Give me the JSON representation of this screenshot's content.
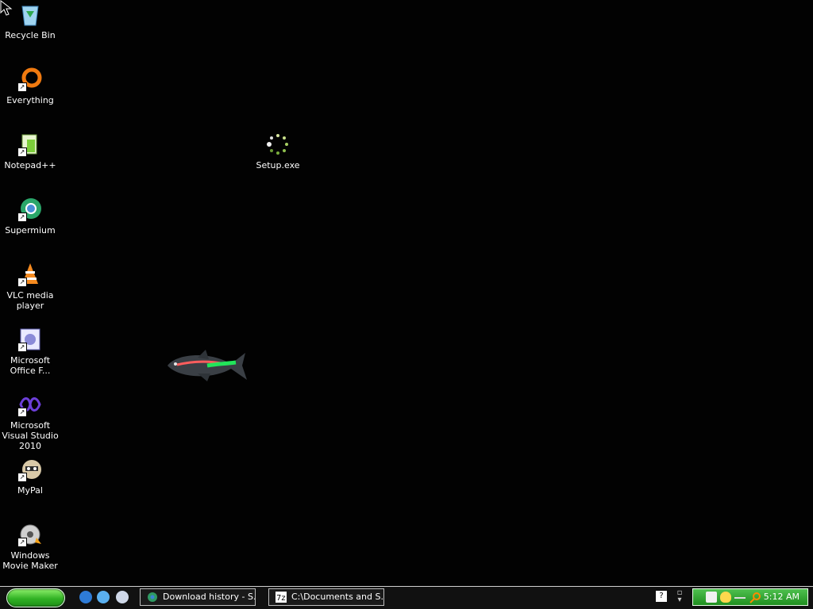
{
  "desktop": {
    "icons": [
      {
        "label": "Recycle Bin",
        "icon": "recycle-bin-icon"
      },
      {
        "label": "Everything",
        "icon": "everything-icon"
      },
      {
        "label": "Notepad++",
        "icon": "notepad-plus-plus-icon"
      },
      {
        "label": "Supermium",
        "icon": "supermium-icon"
      },
      {
        "label": "VLC media player",
        "icon": "vlc-icon"
      },
      {
        "label": "Microsoft Office F...",
        "icon": "office-icon"
      },
      {
        "label": "Microsoft Visual Studio 2010",
        "icon": "visual-studio-icon"
      },
      {
        "label": "MyPal",
        "icon": "mypal-icon"
      },
      {
        "label": "Windows Movie Maker",
        "icon": "movie-maker-icon"
      },
      {
        "label": "Setup.exe",
        "icon": "setup-exe-icon"
      }
    ]
  },
  "taskbar": {
    "tasks": [
      {
        "label": "Download history - S...",
        "icon": "browser-icon"
      },
      {
        "label": "C:\\Documents and S...",
        "icon": "7zip-icon"
      }
    ],
    "clock": "5:12 AM"
  },
  "colors": {
    "tray_green": "#2f9f2f",
    "start_green": "#31b224"
  }
}
